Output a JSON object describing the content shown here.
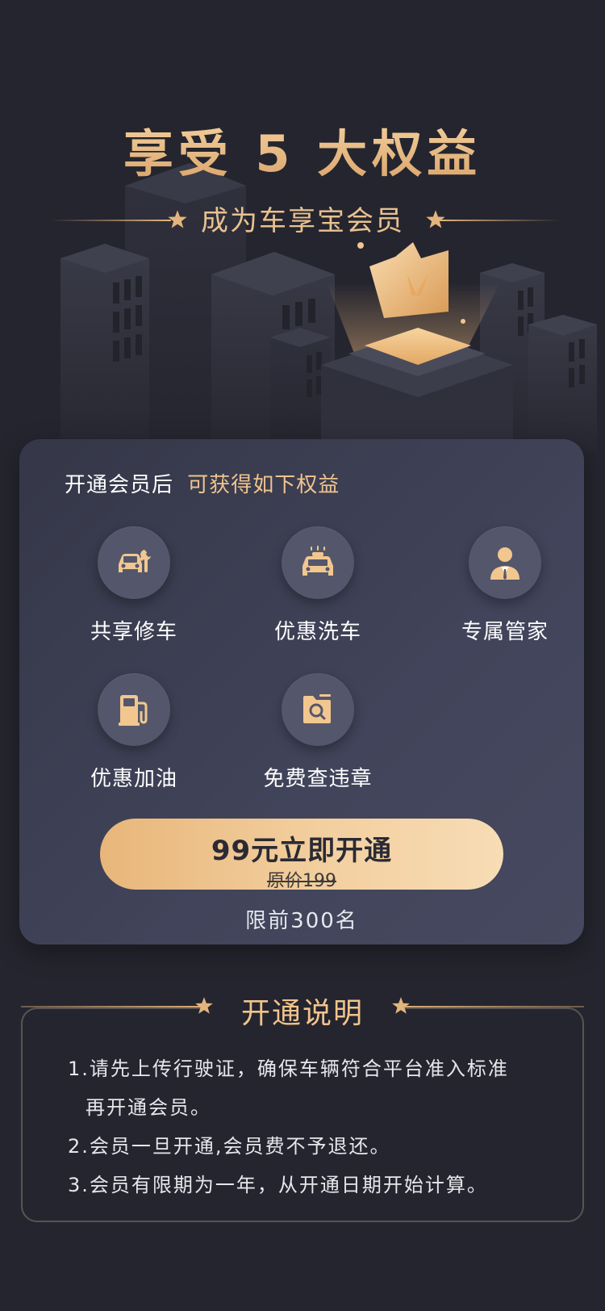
{
  "hero": {
    "title": "享受 5 大权益",
    "subtitle": "成为车享宝会员"
  },
  "card": {
    "intro_white": "开通会员后",
    "intro_gold": "可获得如下权益",
    "benefits": [
      {
        "label": "共享修车",
        "icon": "car-repair-icon"
      },
      {
        "label": "优惠洗车",
        "icon": "car-wash-icon"
      },
      {
        "label": "专属管家",
        "icon": "butler-icon"
      },
      {
        "label": "优惠加油",
        "icon": "fuel-pump-icon"
      },
      {
        "label": "免费查违章",
        "icon": "violation-search-icon"
      }
    ],
    "button_label": "99元立即开通",
    "original_price": "原价199",
    "limit_text": "限前300名"
  },
  "notes": {
    "title": "开通说明",
    "items": [
      "1.请先上传行驶证，确保车辆符合平台准入标准",
      "再开通会员。",
      "2.会员一旦开通,会员费不予退还。",
      "3.会员有限期为一年，从开通日期开始计算。"
    ]
  },
  "colors": {
    "background": "#25252f",
    "card": "#3c3f52",
    "gold": "#f0c48e",
    "button_start": "#e8b67a",
    "button_end": "#f7dcb5"
  }
}
